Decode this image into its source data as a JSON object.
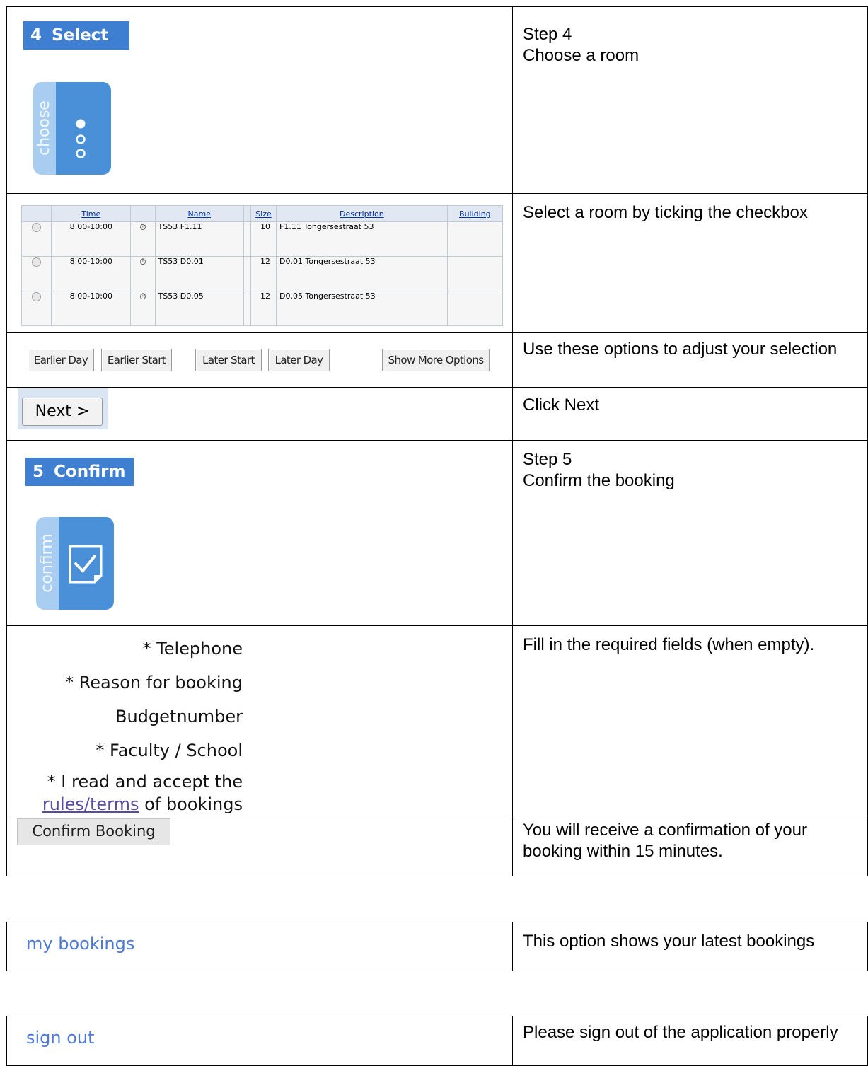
{
  "step4": {
    "header_num": "4",
    "header_label": "Select",
    "icon_word": "choose",
    "desc_line1": "Step 4",
    "desc_line2": "Choose a room"
  },
  "rooms": {
    "headers": [
      "Time",
      "Name",
      "Size",
      "Description",
      "Building"
    ],
    "rows": [
      {
        "time": "8:00-10:00",
        "name": "TS53 F1.11",
        "size": "10",
        "description": "F1.11 Tongersestraat 53",
        "building": ""
      },
      {
        "time": "8:00-10:00",
        "name": "TS53 D0.01",
        "size": "12",
        "description": "D0.01 Tongersestraat 53",
        "building": ""
      },
      {
        "time": "8:00-10:00",
        "name": "TS53 D0.05",
        "size": "12",
        "description": "D0.05 Tongersestraat 53",
        "building": ""
      }
    ],
    "desc": "Select a room by ticking the checkbox"
  },
  "options": {
    "earlier_day": "Earlier Day",
    "earlier_start": "Earlier Start",
    "later_start": "Later Start",
    "later_day": "Later Day",
    "show_more": "Show More Options",
    "desc": "Use these options to adjust your selection"
  },
  "next": {
    "label": "Next >",
    "desc": "Click Next"
  },
  "step5": {
    "header_num": "5",
    "header_label": "Confirm",
    "icon_word": "confirm",
    "desc_line1": "Step 5",
    "desc_line2": "Confirm the booking"
  },
  "form": {
    "telephone": "* Telephone",
    "reason": "* Reason for booking",
    "budget": "Budgetnumber",
    "faculty": "* Faculty / School",
    "accept_line1": "* I read and accept the",
    "accept_link": "rules/terms",
    "accept_line2_rest": " of bookings",
    "desc": "Fill in the required fields (when empty)."
  },
  "confirm": {
    "label": "Confirm Booking",
    "desc": "You will receive a confirmation of your booking within 15 minutes."
  },
  "my_bookings": {
    "label": "my bookings",
    "desc": "This option shows your latest bookings"
  },
  "sign_out": {
    "label": "sign out",
    "desc": "Please sign out of the application properly"
  },
  "colors": {
    "header_blue": "#3f7fd1",
    "icon_blue": "#4a90d9",
    "icon_light": "#a9cdf0",
    "link_blue": "#4d7ad8"
  }
}
